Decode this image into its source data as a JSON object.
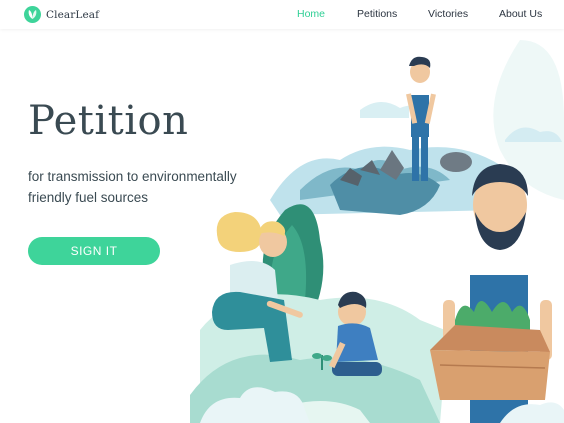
{
  "brand": {
    "name": "ClearLeaf",
    "logo_icon": "leaf-icon",
    "accent_color": "#2fcf95"
  },
  "nav": {
    "items": [
      {
        "label": "Home",
        "active": true
      },
      {
        "label": "Petitions",
        "active": false
      },
      {
        "label": "Victories",
        "active": false
      },
      {
        "label": "About Us",
        "active": false
      }
    ]
  },
  "hero": {
    "title": "Petition",
    "subtitle": "for transmission to environmentally friendly fuel sources",
    "cta_label": "SIGN IT",
    "cta_color": "#3ed49a"
  }
}
